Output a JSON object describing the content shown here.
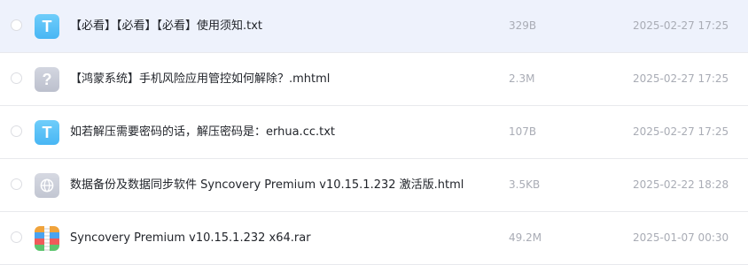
{
  "files": [
    {
      "name": "【必看】【必看】【必看】使用须知.txt",
      "size": "329B",
      "date": "2025-02-27 17:25",
      "icon": "txt-file-icon",
      "selected": true
    },
    {
      "name": "【鸿蒙系统】手机风险应用管控如何解除？.mhtml",
      "size": "2.3M",
      "date": "2025-02-27 17:25",
      "icon": "unknown-file-icon",
      "selected": false
    },
    {
      "name": "如若解压需要密码的话，解压密码是：erhua.cc.txt",
      "size": "107B",
      "date": "2025-02-27 17:25",
      "icon": "txt-file-icon",
      "selected": false
    },
    {
      "name": "数据备份及数据同步软件 Syncovery Premium v10.15.1.232 激活版.html",
      "size": "3.5KB",
      "date": "2025-02-22 18:28",
      "icon": "html-file-icon",
      "selected": false
    },
    {
      "name": "Syncovery Premium v10.15.1.232 x64.rar",
      "size": "49.2M",
      "date": "2025-01-07 00:30",
      "icon": "rar-archive-icon",
      "selected": false
    }
  ],
  "colors": {
    "selected_row_bg": "#eef2fc",
    "txt_icon": "#48b6f4",
    "meta_text": "#a9acb5",
    "name_text": "#22252b"
  }
}
